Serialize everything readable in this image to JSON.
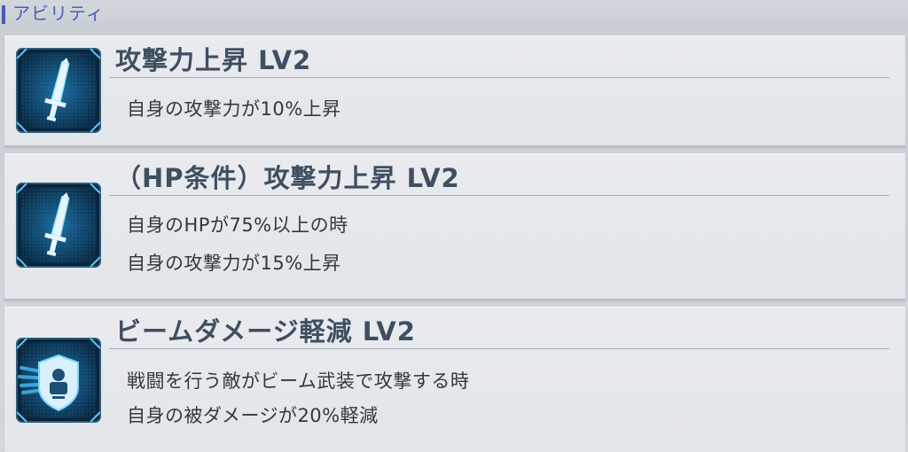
{
  "section": {
    "title": "アビリティ"
  },
  "abilities": [
    {
      "icon": "sword-icon",
      "name": "攻撃力上昇 LV2",
      "lines": [
        "自身の攻撃力が10%上昇"
      ]
    },
    {
      "icon": "sword-icon",
      "name": "（HP条件）攻撃力上昇 LV2",
      "lines": [
        "自身のHPが75%以上の時",
        "自身の攻撃力が15%上昇"
      ]
    },
    {
      "icon": "beam-shield-icon",
      "name": "ビームダメージ軽減 LV2",
      "lines": [
        "戦闘を行う敵がビーム武装で攻撃する時",
        "自身の被ダメージが20%軽減"
      ]
    }
  ],
  "colors": {
    "accent": "#4c57b8",
    "icon_bg": "#0d3c5e",
    "icon_glow": "#3fb6f0",
    "title_text": "#3f4f62"
  }
}
